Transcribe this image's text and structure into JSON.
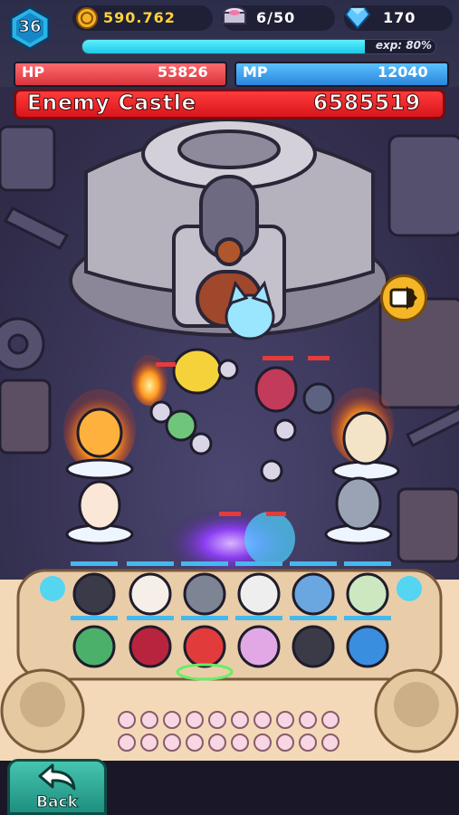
{
  "player": {
    "level": "36"
  },
  "currencies": {
    "gold": "590.762",
    "sushi": "6/50",
    "gems": "170"
  },
  "exp": {
    "label": "exp: 80%",
    "progress": 0.8
  },
  "stats": {
    "hp": {
      "label": "HP",
      "value": "53826",
      "color": "#e8434a"
    },
    "mp": {
      "label": "MP",
      "value": "12040",
      "color": "#2f9df0"
    }
  },
  "enemy_castle": {
    "label": "Enemy Castle",
    "value": "6585519"
  },
  "buttons": {
    "back": "Back"
  },
  "colors": {
    "hp": "#e8434a",
    "mp": "#2f9df0",
    "exp": "#29d5ee",
    "castle": "#e82a2f",
    "back": "#2aa896",
    "gold": "#ffd23a",
    "gem": "#5fc6ff"
  },
  "icons": [
    "level-hexagon-icon",
    "gold-coin-icon",
    "sushi-icon",
    "gem-icon",
    "fast-forward-icon",
    "back-arrow-icon"
  ]
}
